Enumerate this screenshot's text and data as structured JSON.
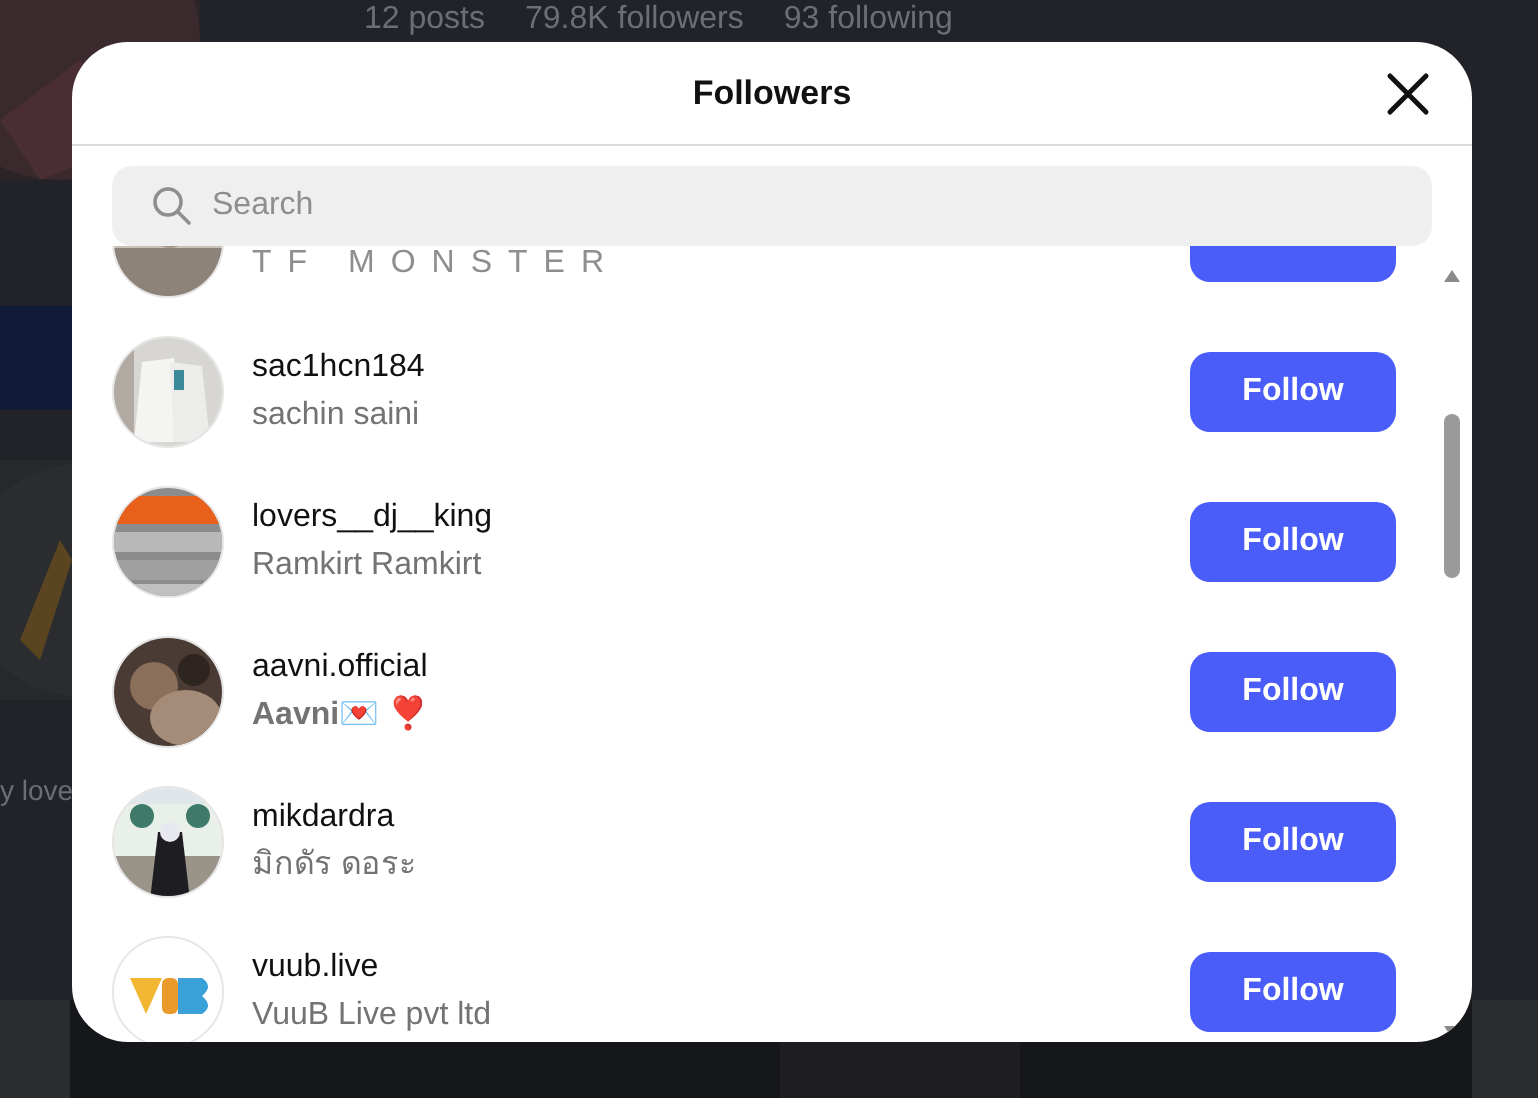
{
  "background": {
    "stats": [
      "12 posts",
      "79.8K followers",
      "93 following"
    ],
    "caption": "y love"
  },
  "dialog": {
    "title": "Followers",
    "search": {
      "placeholder": "Search"
    },
    "followers": [
      {
        "display_name": "TF MONSTER"
      },
      {
        "username": "sac1hcn184",
        "display_name": "sachin saini",
        "button": "Follow"
      },
      {
        "username": "lovers__dj__king",
        "display_name": "Ramkirt Ramkirt",
        "button": "Follow"
      },
      {
        "username": "aavni.official",
        "display_name": "**Aavni**💌 ❣️",
        "button": "Follow"
      },
      {
        "username": "mikdardra",
        "display_name": "มิกดัร ดอระ",
        "button": "Follow"
      },
      {
        "username": "vuub.live",
        "display_name": "VuuB Live pvt ltd",
        "button": "Follow"
      }
    ]
  }
}
